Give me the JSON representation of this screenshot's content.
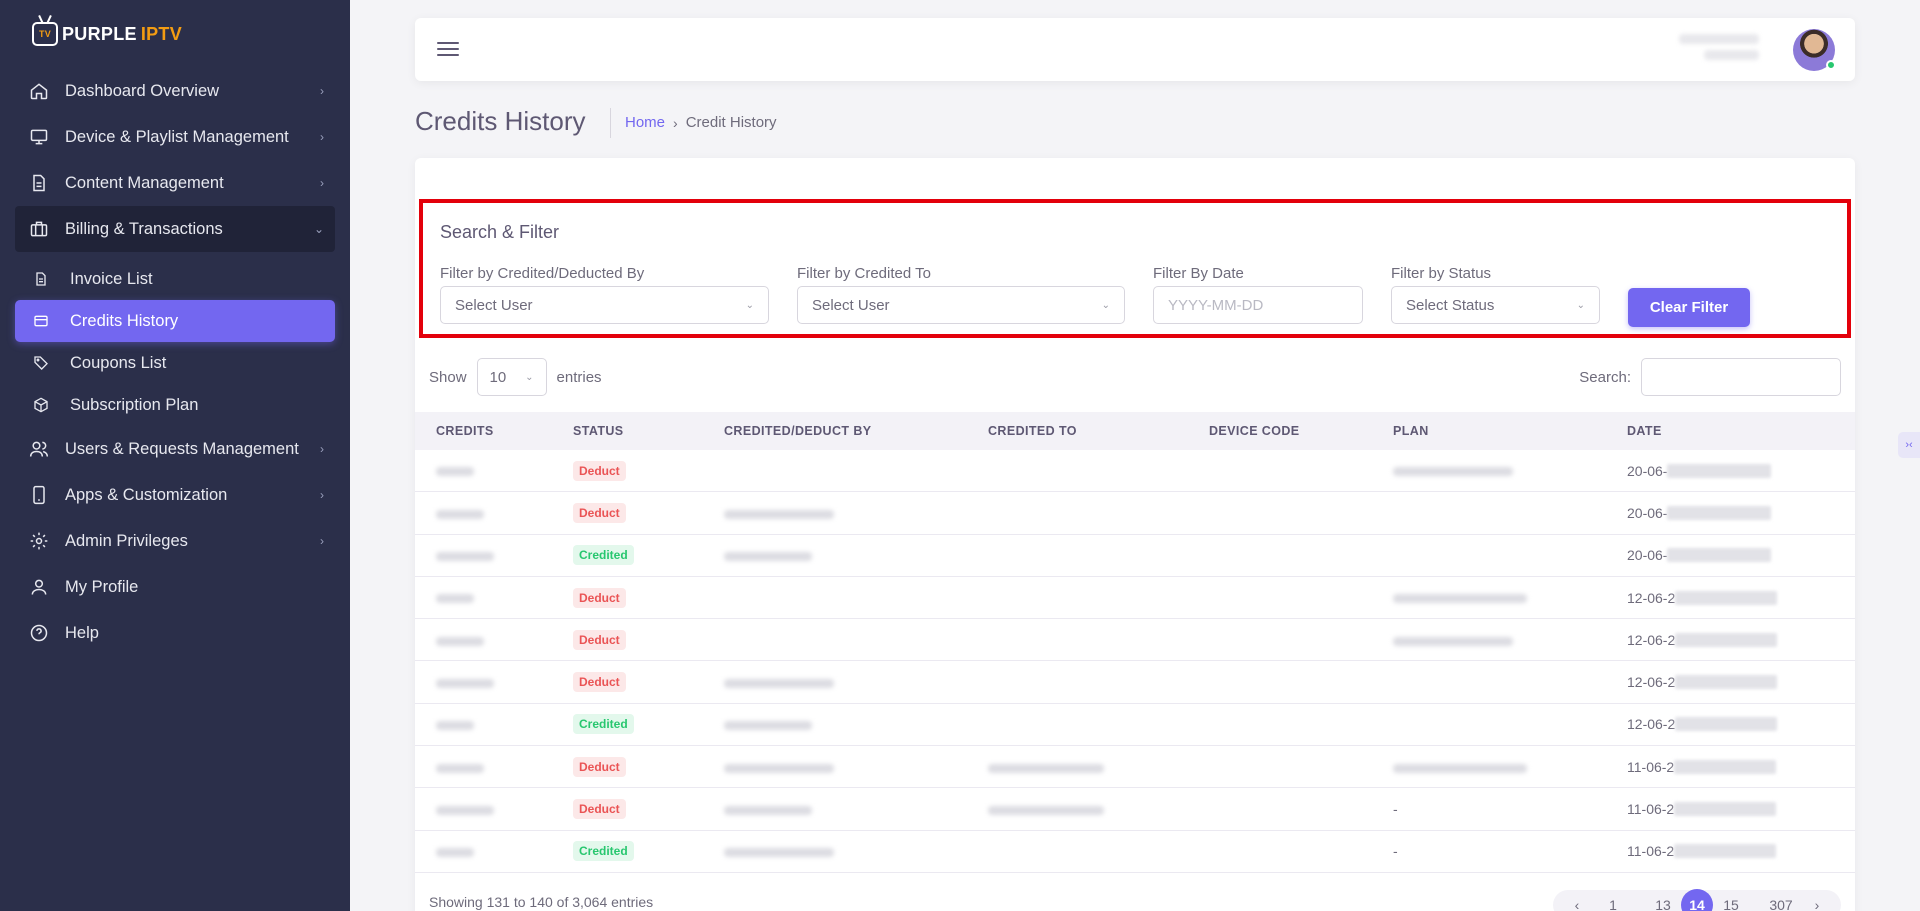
{
  "brand": {
    "part1": "PURPLE",
    "part2": "IPTV",
    "tv": "TV"
  },
  "sidebar": {
    "items": [
      {
        "label": "Dashboard Overview"
      },
      {
        "label": "Device & Playlist Management"
      },
      {
        "label": "Content Management"
      },
      {
        "label": "Billing & Transactions"
      },
      {
        "label": "Invoice List"
      },
      {
        "label": "Credits History"
      },
      {
        "label": "Coupons List"
      },
      {
        "label": "Subscription Plan"
      },
      {
        "label": "Users & Requests Management"
      },
      {
        "label": "Apps & Customization"
      },
      {
        "label": "Admin Privileges"
      },
      {
        "label": "My Profile"
      },
      {
        "label": "Help"
      }
    ]
  },
  "page": {
    "title": "Credits History"
  },
  "breadcrumb": {
    "home": "Home",
    "current": "Credit History"
  },
  "filter": {
    "title": "Search & Filter",
    "by_credited_deducted": {
      "label": "Filter by Credited/Deducted By",
      "value": "Select User"
    },
    "by_credited_to": {
      "label": "Filter by Credited To",
      "value": "Select User"
    },
    "by_date": {
      "label": "Filter By Date",
      "placeholder": "YYYY-MM-DD"
    },
    "by_status": {
      "label": "Filter by Status",
      "value": "Select Status"
    },
    "clear_label": "Clear Filter"
  },
  "table_controls": {
    "show_label": "Show",
    "entries_value": "10",
    "entries_label": "entries",
    "search_label": "Search:"
  },
  "table": {
    "headers": [
      "CREDITS",
      "STATUS",
      "CREDITED/DEDUCT BY",
      "CREDITED TO",
      "DEVICE CODE",
      "PLAN",
      "DATE"
    ],
    "rows": [
      {
        "status": "Deduct",
        "plan": "",
        "date": "20-06-"
      },
      {
        "status": "Deduct",
        "plan": "",
        "date": "20-06-"
      },
      {
        "status": "Credited",
        "plan": "",
        "date": "20-06-"
      },
      {
        "status": "Deduct",
        "plan": "",
        "date": "12-06-2"
      },
      {
        "status": "Deduct",
        "plan": "",
        "date": "12-06-2"
      },
      {
        "status": "Deduct",
        "plan": "",
        "date": "12-06-2"
      },
      {
        "status": "Credited",
        "plan": "",
        "date": "12-06-2"
      },
      {
        "status": "Deduct",
        "plan": "",
        "date": "11-06-2"
      },
      {
        "status": "Deduct",
        "plan": "-",
        "date": "11-06-2"
      },
      {
        "status": "Credited",
        "plan": "-",
        "date": "11-06-2"
      }
    ]
  },
  "footer": {
    "info": "Showing 131 to 140 of 3,064 entries",
    "pages": [
      "1",
      "13",
      "14",
      "15",
      "307"
    ],
    "current_page": "14"
  },
  "colors": {
    "accent": "#7367f0",
    "sidebar": "#2b2f4a",
    "deduct": "#ea5455",
    "credited": "#28c76f",
    "highlight": "#e3000b"
  }
}
